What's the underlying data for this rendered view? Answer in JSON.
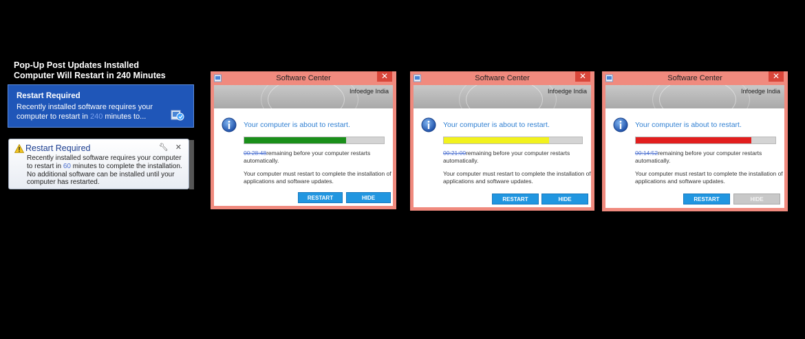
{
  "caption": {
    "line1": "Pop-Up Post Updates Installed",
    "line2": "Computer Will Restart in 240 Minutes"
  },
  "toast": {
    "title": "Restart Required",
    "body_prefix": "Recently installed software requires your computer to restart in",
    "minutes": "240",
    "body_suffix": "minutes to...",
    "icon": "software-center-icon"
  },
  "balloon": {
    "title": "Restart Required",
    "body_prefix": "Recently installed software requires your computer to restart in",
    "minutes": "60",
    "body_suffix": "minutes to complete the installation. No additional software can be installed until your computer has restarted.",
    "icons": [
      "warning-icon",
      "tools-icon",
      "close-icon"
    ]
  },
  "dialogs": [
    {
      "title": "Software Center",
      "close_label": "✕",
      "org": "Infoedge India",
      "heading": "Your computer is about to restart.",
      "countdown": "00:28:48",
      "remaining": "remaining before your computer restarts automatically.",
      "message": "Your computer must restart to complete the installation of applications and software updates.",
      "progress_fraction": 0.73,
      "progress_color": "#1a8f1a",
      "restart_label": "RESTART",
      "hide_label": "HIDE",
      "hide_enabled": true
    },
    {
      "title": "Software Center",
      "close_label": "✕",
      "org": "Infoedge India",
      "heading": "Your computer is about to restart.",
      "countdown": "00:21:00",
      "remaining": "remaining before your computer restarts automatically.",
      "message": "Your computer must restart to complete the installation of applications and software updates.",
      "progress_fraction": 0.76,
      "progress_color": "#f2f21e",
      "restart_label": "RESTART",
      "hide_label": "HIDE",
      "hide_enabled": true
    },
    {
      "title": "Software Center",
      "close_label": "✕",
      "org": "Infoedge India",
      "heading": "Your computer is about to restart.",
      "countdown": "00:14:52",
      "remaining": "remaining before your computer restarts automatically.",
      "message": "Your computer must restart to complete the installation of applications and software updates.",
      "progress_fraction": 0.83,
      "progress_color": "#e21e1e",
      "restart_label": "RESTART",
      "hide_label": "HIDE",
      "hide_enabled": false
    }
  ]
}
